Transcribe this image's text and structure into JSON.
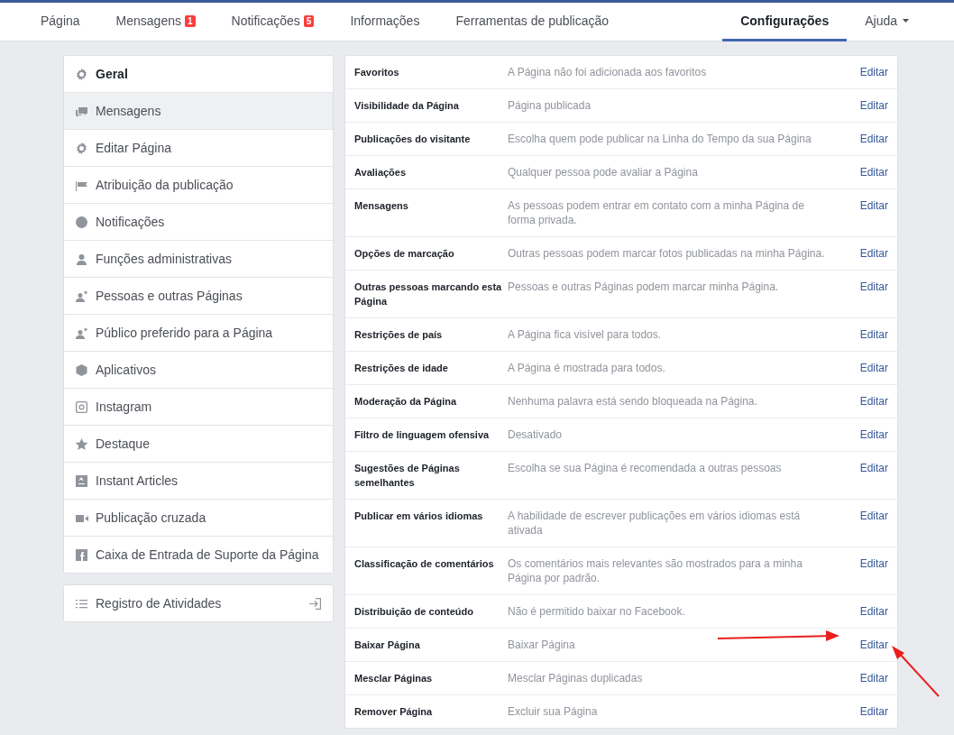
{
  "nav": {
    "tabs": [
      {
        "label": "Página",
        "selected": false
      },
      {
        "label": "Mensagens",
        "badge": "1",
        "selected": false
      },
      {
        "label": "Notificações",
        "badge": "5",
        "selected": false
      },
      {
        "label": "Informações",
        "selected": false
      },
      {
        "label": "Ferramentas de publicação",
        "selected": false
      },
      {
        "label": "Configurações",
        "selected": true
      },
      {
        "label": "Ajuda",
        "dropdown": true,
        "selected": false
      }
    ]
  },
  "sidebar": {
    "items": [
      {
        "label": "Geral",
        "selected": true,
        "hovered": false
      },
      {
        "label": "Mensagens",
        "selected": false,
        "hovered": true
      },
      {
        "label": "Editar Página",
        "selected": false,
        "hovered": false
      },
      {
        "label": "Atribuição da publicação",
        "selected": false,
        "hovered": false
      },
      {
        "label": "Notificações",
        "selected": false,
        "hovered": false
      },
      {
        "label": "Funções administrativas",
        "selected": false,
        "hovered": false
      },
      {
        "label": "Pessoas e outras Páginas",
        "selected": false,
        "hovered": false
      },
      {
        "label": "Público preferido para a Página",
        "selected": false,
        "hovered": false
      },
      {
        "label": "Aplicativos",
        "selected": false,
        "hovered": false
      },
      {
        "label": "Instagram",
        "selected": false,
        "hovered": false
      },
      {
        "label": "Destaque",
        "selected": false,
        "hovered": false
      },
      {
        "label": "Instant Articles",
        "selected": false,
        "hovered": false
      },
      {
        "label": "Publicação cruzada",
        "selected": false,
        "hovered": false
      },
      {
        "label": "Caixa de Entrada de Suporte da Página",
        "selected": false,
        "hovered": false
      }
    ],
    "activity_log": {
      "label": "Registro de Atividades"
    }
  },
  "settings": {
    "rows": [
      {
        "label": "Favoritos",
        "value": "A Página não foi adicionada aos favoritos",
        "action": "Editar"
      },
      {
        "label": "Visibilidade da Página",
        "value": "Página publicada",
        "action": "Editar"
      },
      {
        "label": "Publicações do visitante",
        "value": "Escolha quem pode publicar na Linha do Tempo da sua Página",
        "action": "Editar"
      },
      {
        "label": "Avaliações",
        "value": "Qualquer pessoa pode avaliar a Página",
        "action": "Editar"
      },
      {
        "label": "Mensagens",
        "value": "As pessoas podem entrar em contato com a minha Página de forma privada.",
        "action": "Editar"
      },
      {
        "label": "Opções de marcação",
        "value": "Outras pessoas podem marcar fotos publicadas na minha Página.",
        "action": "Editar"
      },
      {
        "label": "Outras pessoas marcando esta Página",
        "value": "Pessoas e outras Páginas podem marcar minha Página.",
        "action": "Editar"
      },
      {
        "label": "Restrições de país",
        "value": "A Página fica visível para todos.",
        "action": "Editar"
      },
      {
        "label": "Restrições de idade",
        "value": "A Página é mostrada para todos.",
        "action": "Editar"
      },
      {
        "label": "Moderação da Página",
        "value": "Nenhuma palavra está sendo bloqueada na Página.",
        "action": "Editar"
      },
      {
        "label": "Filtro de linguagem ofensiva",
        "value": "Desativado",
        "action": "Editar"
      },
      {
        "label": "Sugestões de Páginas semelhantes",
        "value": "Escolha se sua Página é recomendada a outras pessoas",
        "action": "Editar"
      },
      {
        "label": "Publicar em vários idiomas",
        "value": "A habilidade de escrever publicações em vários idiomas está ativada",
        "action": "Editar"
      },
      {
        "label": "Classificação de comentários",
        "value": "Os comentários mais relevantes são mostrados para a minha Página por padrão.",
        "action": "Editar"
      },
      {
        "label": "Distribuição de conteúdo",
        "value": "Não é permitido baixar no Facebook.",
        "action": "Editar"
      },
      {
        "label": "Baixar Página",
        "value": "Baixar Página",
        "action": "Editar"
      },
      {
        "label": "Mesclar Páginas",
        "value": "Mesclar Páginas duplicadas",
        "action": "Editar"
      },
      {
        "label": "Remover Página",
        "value": "Excluir sua Página",
        "action": "Editar"
      }
    ]
  }
}
